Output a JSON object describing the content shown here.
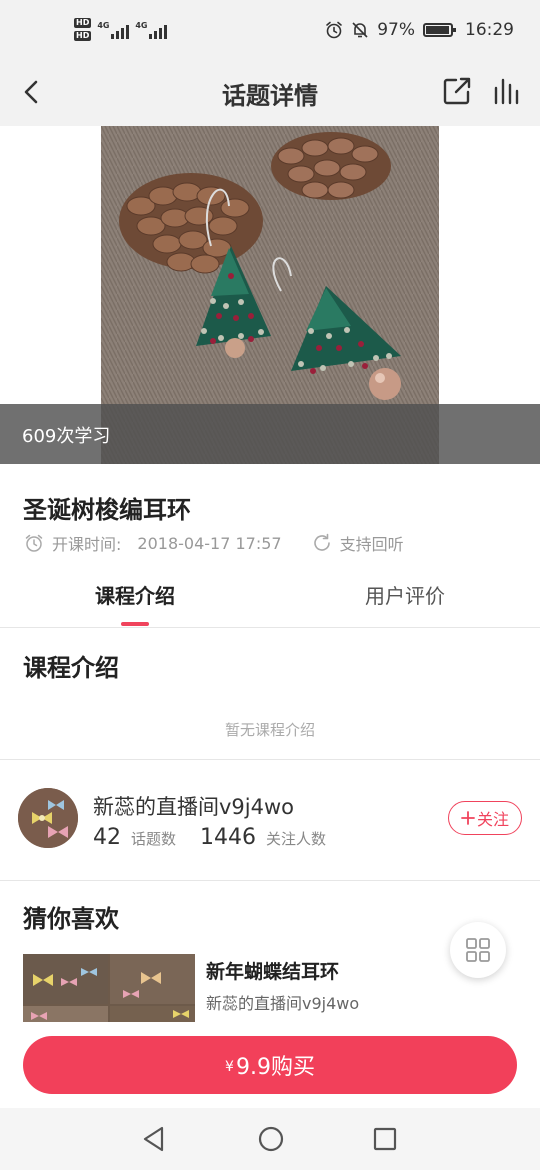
{
  "status_bar": {
    "net1": "4G",
    "net2": "4G",
    "battery_percent": "97%",
    "battery_level": 0.97,
    "time": "16:29",
    "icons": [
      "hd-icon",
      "signal-icon",
      "alarm-icon",
      "mute-icon",
      "battery-icon"
    ]
  },
  "nav": {
    "title": "话题详情",
    "icons": [
      "back-arrow-icon",
      "share-icon",
      "stats-icon"
    ]
  },
  "hero": {
    "study_count": "609次学习"
  },
  "course": {
    "title": "圣诞树梭编耳环",
    "time_label": "开课时间:",
    "time_value": "2018-04-17 17:57",
    "replay": "支持回听"
  },
  "tabs": [
    {
      "label": "课程介绍",
      "active": true
    },
    {
      "label": "用户评价",
      "active": false
    }
  ],
  "intro": {
    "heading": "课程介绍",
    "empty": "暂无课程介绍"
  },
  "host": {
    "name": "新蕊的直播间v9j4wo",
    "topics_count": "42",
    "topics_label": "话题数",
    "followers_count": "1446",
    "followers_label": "关注人数",
    "follow_label": "关注"
  },
  "recommend": {
    "heading": "猜你喜欢",
    "items": [
      {
        "title": "新年蝴蝶结耳环",
        "subtitle": "新蕊的直播间v9j4wo"
      }
    ]
  },
  "buy": {
    "currency": "¥",
    "label": "9.9购买"
  },
  "colors": {
    "accent": "#f0435c",
    "buy_button": "#f2405a",
    "header_bg": "#f2f2f2"
  }
}
